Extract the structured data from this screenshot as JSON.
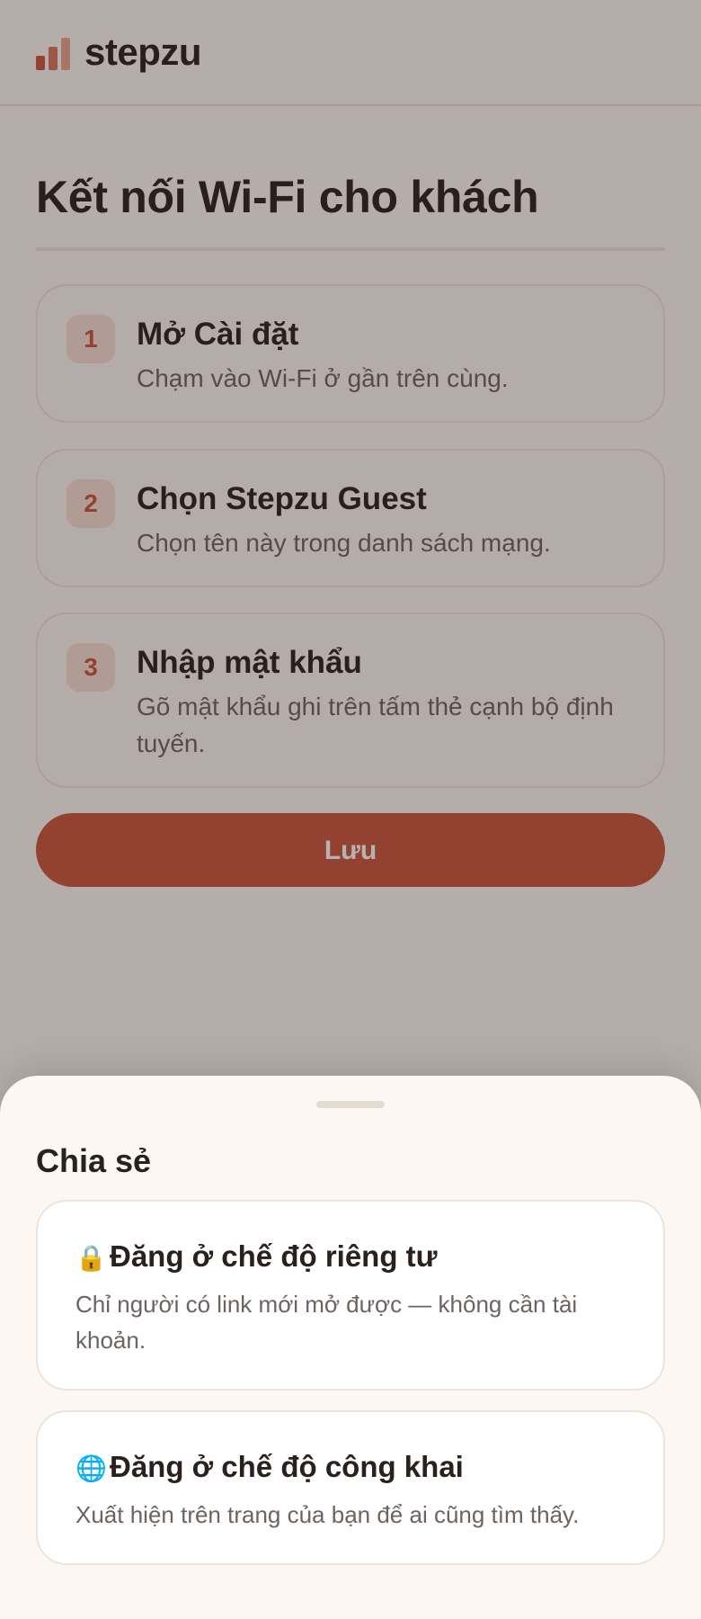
{
  "app": {
    "brand": "stepzu",
    "logo_icon": "bar-chart-icon",
    "accent_color": "#c9563d"
  },
  "main": {
    "title": "Kết nối Wi-Fi cho khách",
    "steps": [
      {
        "number": "1",
        "title": "Mở Cài đặt",
        "description": "Chạm vào Wi-Fi ở gần trên cùng."
      },
      {
        "number": "2",
        "title": "Chọn Stepzu Guest",
        "description": "Chọn tên này trong danh sách mạng."
      },
      {
        "number": "3",
        "title": "Nhập mật khẩu",
        "description": "Gõ mật khẩu ghi trên tấm thẻ cạnh bộ định tuyến."
      }
    ],
    "save_label": "Lưu"
  },
  "share_sheet": {
    "title": "Chia sẻ",
    "options": [
      {
        "icon": "lock-icon",
        "glyph": "🔒",
        "title": "Đăng ở chế độ riêng tư",
        "description": "Chỉ người có link mới mở được — không cần tài khoản."
      },
      {
        "icon": "globe-icon",
        "glyph": "🌐",
        "title": "Đăng ở chế độ công khai",
        "description": "Xuất hiện trên trang của bạn để ai cũng tìm thấy."
      }
    ]
  }
}
